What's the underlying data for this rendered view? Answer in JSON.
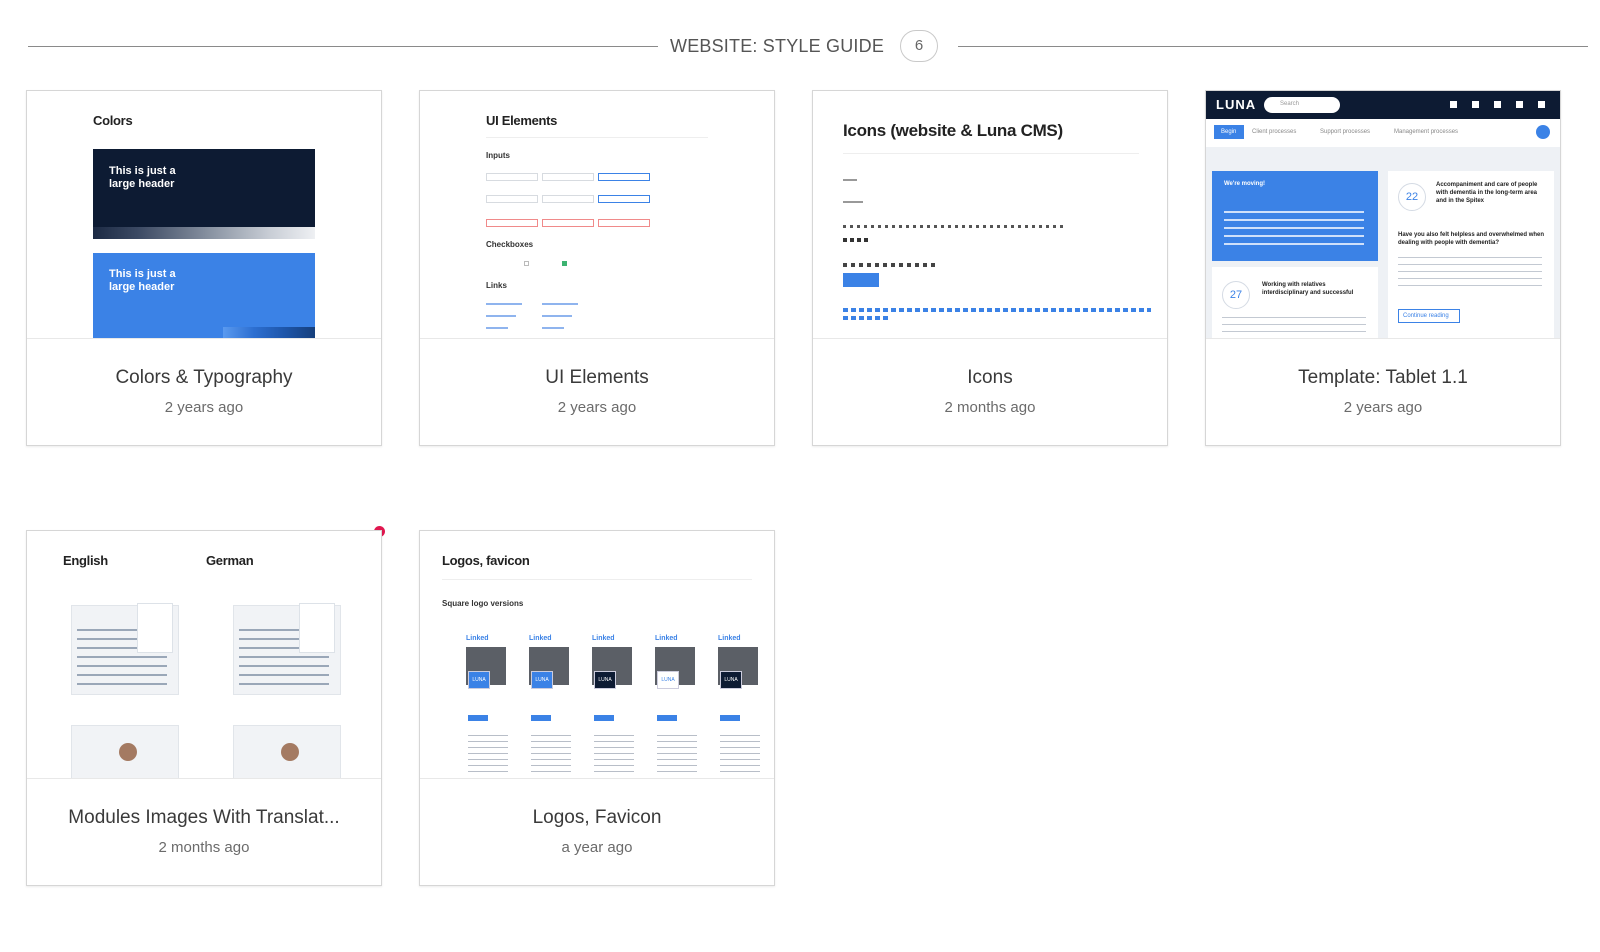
{
  "section": {
    "title": "WEBSITE: STYLE GUIDE",
    "count": "6"
  },
  "cards": [
    {
      "title": "Colors & Typography",
      "time": "2 years ago",
      "thumb": {
        "heading": "Colors",
        "header1": "This is just a\nlarge header",
        "header2": "This is just a\nlarge header"
      }
    },
    {
      "title": "UI Elements",
      "time": "2 years ago",
      "thumb": {
        "heading": "UI Elements",
        "inputs": "Inputs",
        "checkboxes": "Checkboxes",
        "links": "Links"
      }
    },
    {
      "title": "Icons",
      "time": "2 months ago",
      "thumb": {
        "heading": "Icons (website & Luna CMS)"
      }
    },
    {
      "title": "Template: Tablet 1.1",
      "time": "2 years ago",
      "thumb": {
        "logo": "LUNA",
        "search": "Search",
        "nav": [
          "Begin",
          "Client processes",
          "Support processes",
          "Management processes"
        ],
        "moving": "We're moving!",
        "day1": "22",
        "article1": "Accompaniment and care of people with dementia in the long-term area and in the Spitex",
        "question": "Have you also felt helpless and overwhelmed when dealing with people with dementia?",
        "day2": "27",
        "article2": "Working with relatives interdisciplinary and successful",
        "cta": "Continue reading"
      }
    },
    {
      "title": "Modules Images With Translat...",
      "time": "2 months ago",
      "thumb": {
        "lang1": "English",
        "lang2": "German"
      }
    },
    {
      "title": "Logos, Favicon",
      "time": "a year ago",
      "thumb": {
        "heading": "Logos, favicon",
        "subheading": "Square logo versions",
        "brand": "Linked",
        "logo": "LUNA"
      }
    }
  ],
  "colors": {
    "navy": "#0d1b33",
    "blue": "#3b82e6",
    "unread": "#e0174f"
  }
}
